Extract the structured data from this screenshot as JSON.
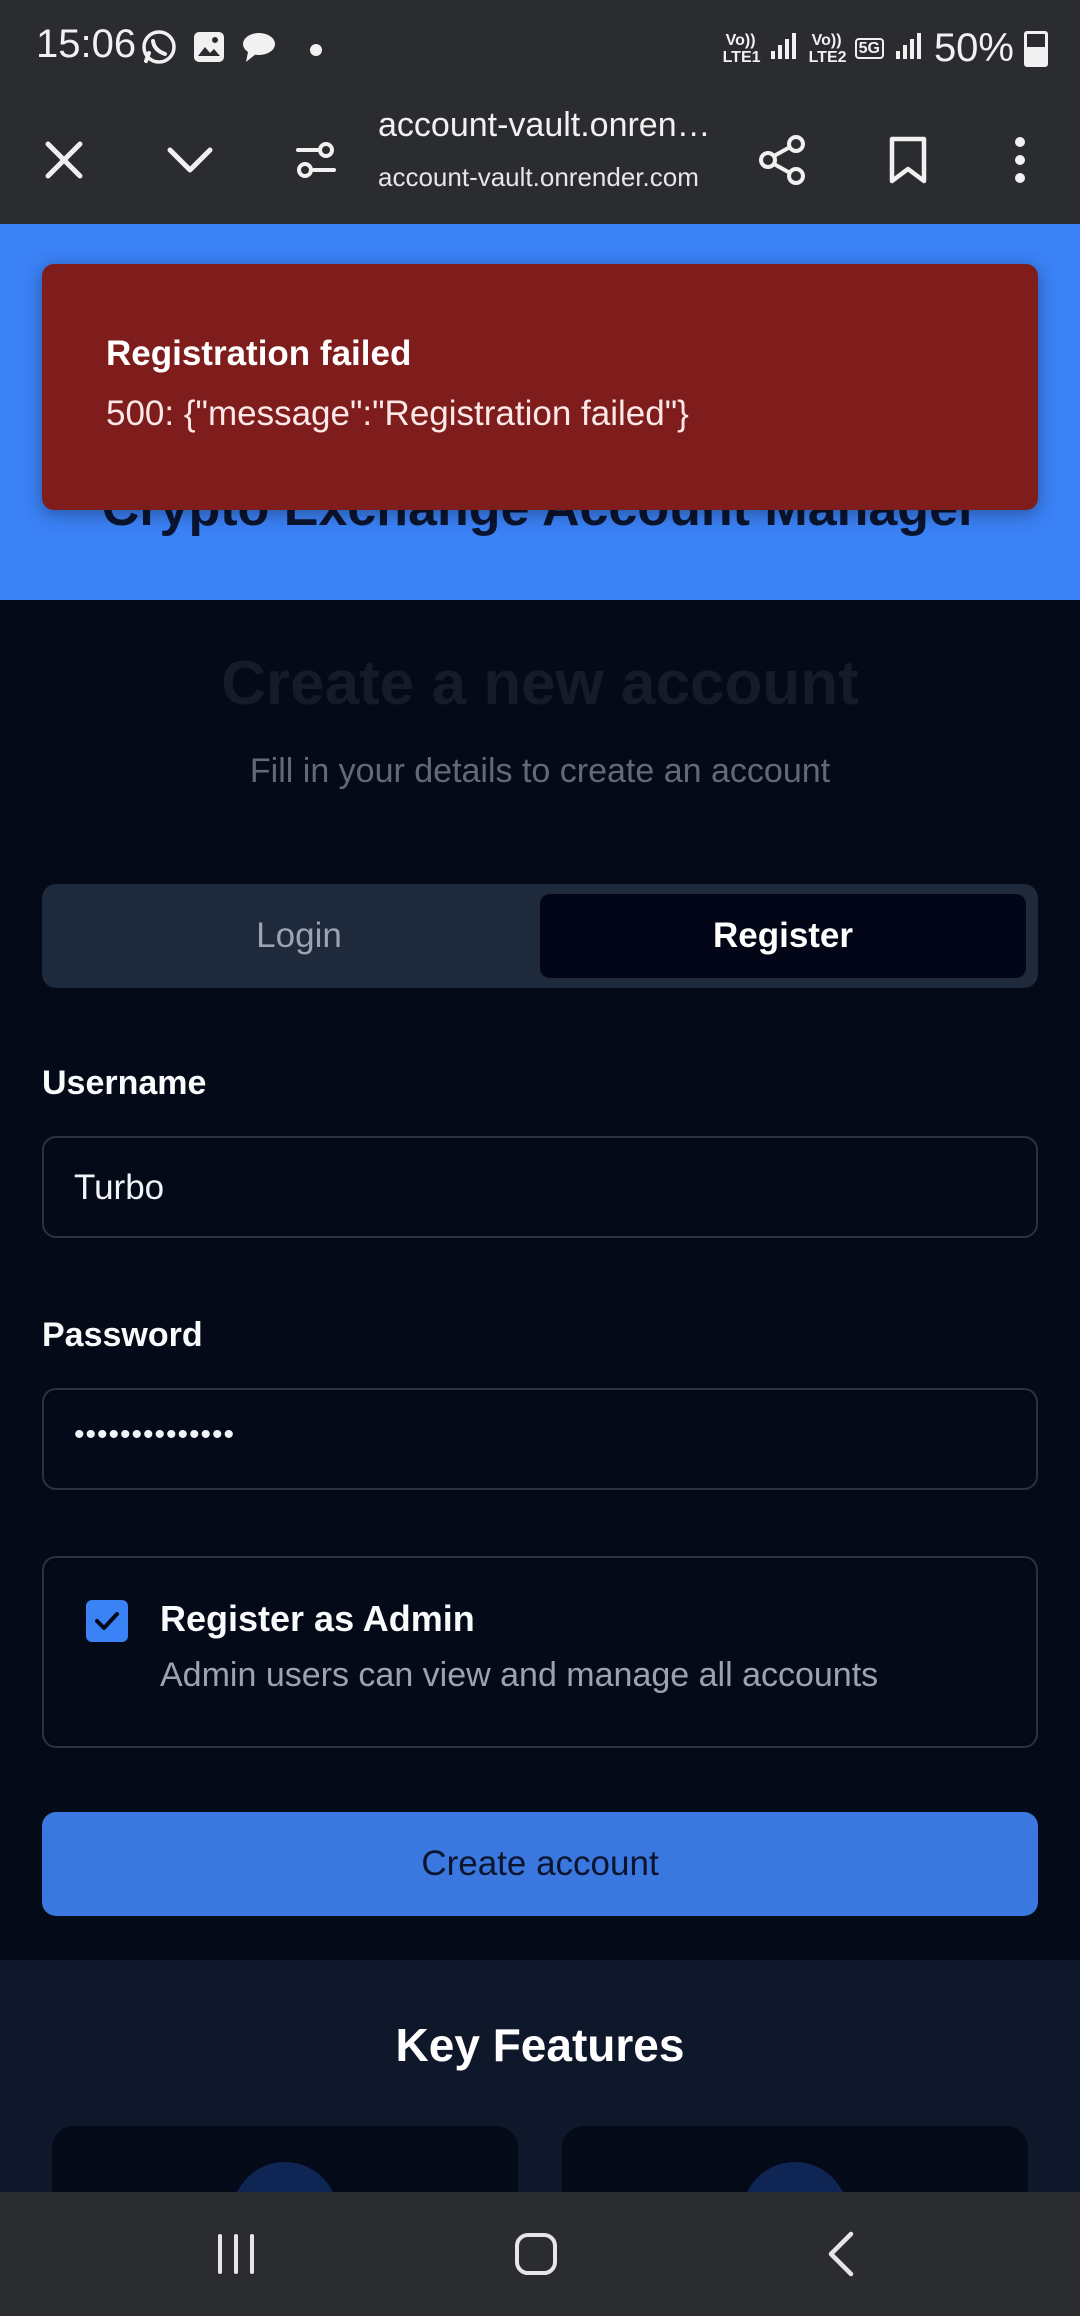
{
  "status_bar": {
    "time": "15:06",
    "notification_icons": [
      "whatsapp-icon",
      "gallery-icon",
      "chat-bubble-icon"
    ],
    "sim1_label": "Vo)) LTE1",
    "sim2_label": "Vo)) LTE2",
    "network_type": "5G",
    "battery": "50%"
  },
  "browser": {
    "url_title": "account-vault.onrender.com",
    "url_domain": "account-vault.onrender.com",
    "icons": [
      "close-icon",
      "chevron-down-icon",
      "site-settings-icon",
      "share-icon",
      "bookmark-icon",
      "more-vert-icon"
    ]
  },
  "hero": {
    "title": "Crypto Exchange Account Manager"
  },
  "toast": {
    "title": "Registration failed",
    "message": "500: {\"message\":\"Registration failed\"}",
    "background": "#7f1d1d"
  },
  "form": {
    "heading": "Create a new account",
    "subheading": "Fill in your details to create an account",
    "tabs": [
      {
        "label": "Login",
        "active": false
      },
      {
        "label": "Register",
        "active": true
      }
    ],
    "username_label": "Username",
    "username_value": "Turbo",
    "password_label": "Password",
    "password_value": "••••••••••••••",
    "admin_checked": true,
    "admin_title": "Register as Admin",
    "admin_description": "Admin users can view and manage all accounts",
    "submit_label": "Create account",
    "accent": "#3b82f6"
  },
  "features": {
    "title": "Key Features"
  }
}
